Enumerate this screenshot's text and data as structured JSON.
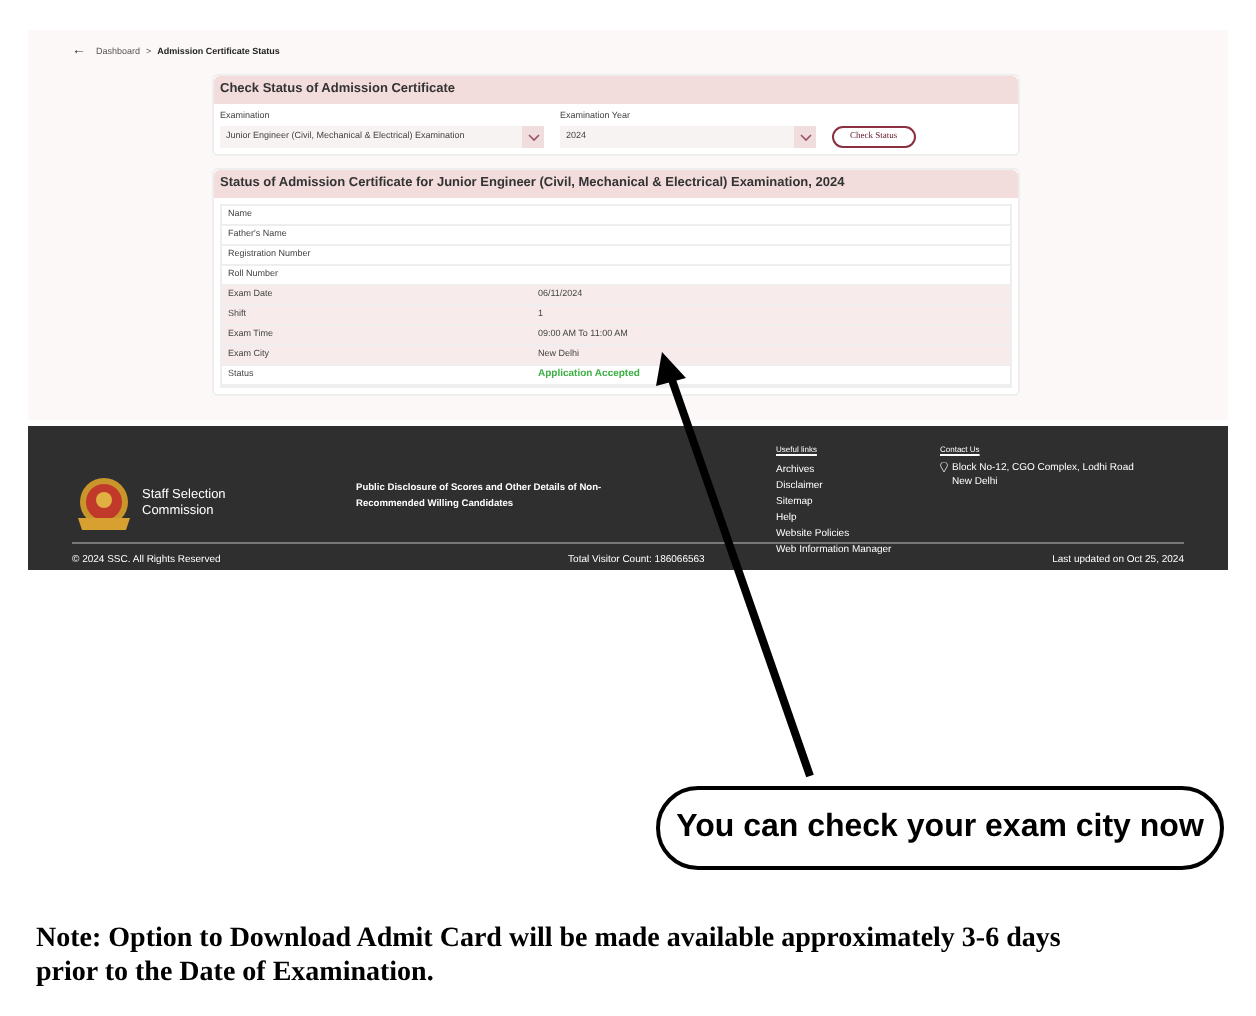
{
  "breadcrumb": {
    "back": "←",
    "items": [
      "Dashboard",
      ">",
      "Admission Certificate Status"
    ]
  },
  "check_card": {
    "title": "Check Status of Admission Certificate",
    "fields": [
      {
        "label": "Examination",
        "value": "Junior Engineer (Civil, Mechanical & Electrical) Examination"
      },
      {
        "label": "Examination Year",
        "value": "2024"
      }
    ],
    "button": "Check Status"
  },
  "status_card": {
    "title": "Status of Admission Certificate for Junior Engineer (Civil, Mechanical & Electrical) Examination, 2024",
    "rows": [
      {
        "label": "Name",
        "highlighted": false
      },
      {
        "label": "Father's Name",
        "highlighted": false
      },
      {
        "label": "Registration Number",
        "highlighted": false
      },
      {
        "label": "Roll Number",
        "highlighted": false
      },
      {
        "label": "Exam Date",
        "value": "06/11/2024",
        "highlighted": true
      },
      {
        "label": "Shift",
        "value": "1",
        "highlighted": true
      },
      {
        "label": "Exam Time",
        "value": "09:00 AM To 11:00 AM",
        "highlighted": true
      },
      {
        "label": "Exam City",
        "value": "New Delhi",
        "highlighted": true
      },
      {
        "label": "Status",
        "value": "Application Accepted",
        "highlighted": false,
        "color": "#3cb043"
      }
    ]
  },
  "footer": {
    "logo_text": [
      "Staff Selection",
      "Commission"
    ],
    "disclosure": "Public Disclosure of Scores and Other Details of Non-Recommended Willing Candidates",
    "useful_links": {
      "title": "Useful links",
      "items": [
        "Archives",
        "Disclaimer",
        "Sitemap",
        "Help",
        "Website Policies",
        "Web Information Manager"
      ]
    },
    "contact": {
      "title": "Contact Us",
      "address": [
        "Block No-12, CGO Complex, Lodhi Road",
        "New Delhi"
      ]
    },
    "copyright": "© 2024 SSC. All Rights Reserved",
    "visitors": "Total Visitor Count: 186066563",
    "updated": "Last updated on Oct 25, 2024"
  },
  "callout": "You can check your exam city now",
  "note": "Note: Option to Download Admit Card will be made available approximately 3-6 days prior to the Date of Examination."
}
